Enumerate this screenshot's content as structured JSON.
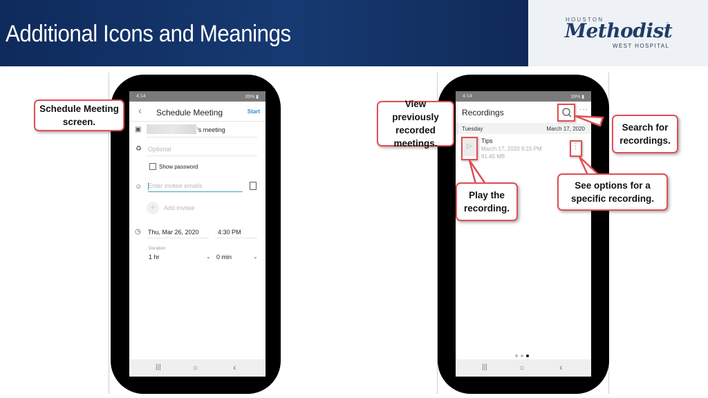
{
  "header": {
    "title": "Additional Icons and Meanings",
    "logo": {
      "top": "HOUSTON",
      "main": "Methodist",
      "trademark": "™",
      "bottom": "WEST HOSPITAL"
    }
  },
  "phone_left": {
    "status": {
      "time": "4:14",
      "battery": "39% ▮"
    },
    "screen_title": "Schedule Meeting",
    "back_icon": "‹",
    "start_label": "Start",
    "meeting_name_suffix": "'s meeting",
    "password_placeholder": "Optional",
    "show_password_label": "Show password",
    "invitee_placeholder": "Enter invitee emails",
    "add_invitee_label": "Add invitee",
    "date": "Thu, Mar 26, 2020",
    "time": "4:30 PM",
    "duration_label": "Duration",
    "duration_hours": "1 hr",
    "duration_minutes": "0 min",
    "nav": {
      "recents": "|||",
      "home": "○",
      "back": "‹"
    }
  },
  "phone_right": {
    "status": {
      "time": "4:14",
      "battery": "39% ▮"
    },
    "screen_title": "Recordings",
    "more_icon": "···",
    "day": "Tuesday",
    "date": "March 17, 2020",
    "recording": {
      "name": "Tips",
      "datetime": "March 17, 2020 9:15 PM",
      "size": "91.45 MB"
    },
    "page_indicator": {
      "total": 3,
      "active": 3
    },
    "nav": {
      "recents": "|||",
      "home": "○",
      "back": "‹"
    }
  },
  "callouts": {
    "schedule": "Schedule Meeting screen.",
    "view": "View previously recorded meetings.",
    "search": "Search for recordings.",
    "play": "Play the recording.",
    "options": "See options for a specific recording."
  },
  "colors": {
    "header_bg": "#0f2a5c",
    "callout_border": "#e04f54",
    "accent_start": "#2a8ad8",
    "input_accent": "#3aa7b5"
  }
}
